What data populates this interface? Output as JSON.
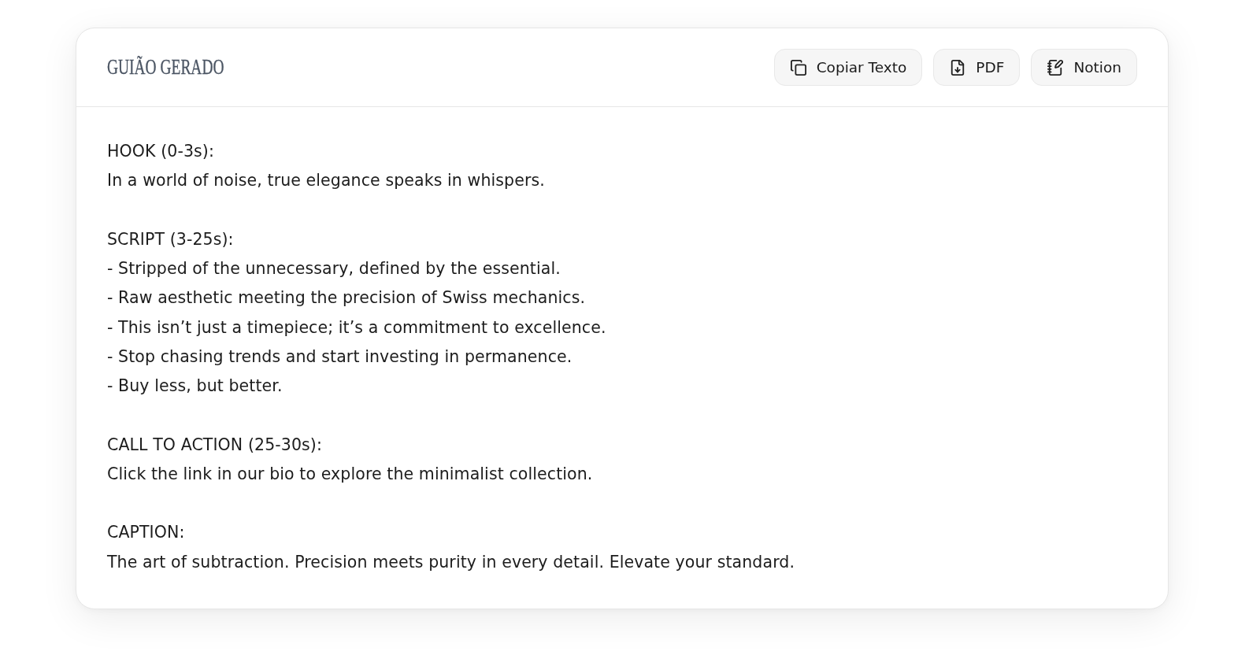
{
  "header": {
    "title": "GUIÃO GERADO",
    "actions": [
      {
        "label": "Copiar Texto"
      },
      {
        "label": "PDF"
      },
      {
        "label": "Notion"
      }
    ]
  },
  "script": {
    "sections": [
      {
        "heading": "HOOK (0-3s):",
        "lines": [
          "In a world of noise, true elegance speaks in whispers."
        ]
      },
      {
        "heading": "SCRIPT (3-25s):",
        "lines": [
          "- Stripped of the unnecessary, defined by the essential.",
          "- Raw aesthetic meeting the precision of Swiss mechanics.",
          "- This isn’t just a timepiece; it’s a commitment to excellence.",
          "- Stop chasing trends and start investing in permanence.",
          "- Buy less, but better."
        ]
      },
      {
        "heading": "CALL TO ACTION (25-30s):",
        "lines": [
          "Click the link in our bio to explore the minimalist collection."
        ]
      },
      {
        "heading": "CAPTION:",
        "lines": [
          "The art of subtraction. Precision meets purity in every detail. Elevate your standard."
        ]
      }
    ]
  }
}
